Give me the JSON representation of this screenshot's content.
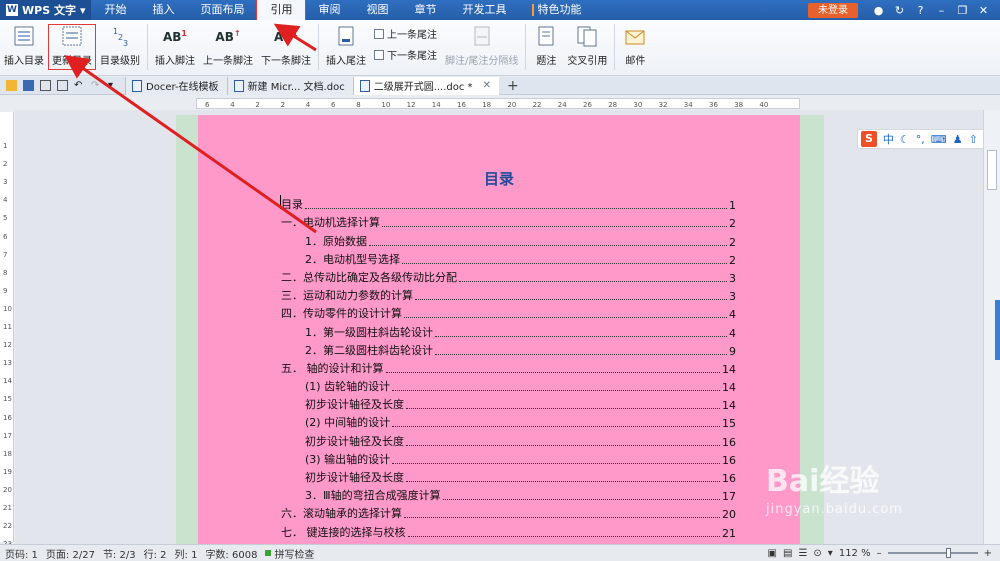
{
  "menubar": {
    "app_name": "WPS 文字",
    "tabs": [
      {
        "label": "开始"
      },
      {
        "label": "插入"
      },
      {
        "label": "页面布局"
      },
      {
        "label": "引用"
      },
      {
        "label": "审阅"
      },
      {
        "label": "视图"
      },
      {
        "label": "章节"
      },
      {
        "label": "开发工具"
      },
      {
        "label": "特色功能"
      }
    ],
    "active_tab": "引用",
    "login_label": "未登录"
  },
  "ribbon": {
    "insert_toc": "插入目录",
    "update_toc": "更新目录",
    "toc_level": "目录级别",
    "insert_footnote": "插入脚注",
    "prev_footnote": "上一条脚注",
    "next_footnote": "下一条脚注",
    "insert_endnote": "插入尾注",
    "prev_endnote": "上一条尾注",
    "next_endnote": "下一条尾注",
    "separator_line": "脚注/尾注分隔线",
    "caption": "题注",
    "cross_ref": "交叉引用",
    "mail": "邮件"
  },
  "tabs": [
    {
      "label": "Docer-在线模板"
    },
    {
      "label": "新建 Micr... 文档.doc"
    },
    {
      "label": "二级展开式圆....doc *"
    }
  ],
  "ruler_labels": [
    "6",
    "4",
    "2",
    "2",
    "4",
    "6",
    "8",
    "10",
    "12",
    "14",
    "16",
    "18",
    "20",
    "22",
    "24",
    "26",
    "28",
    "30",
    "32",
    "34",
    "36",
    "38",
    "40"
  ],
  "vruler_labels": [
    "1",
    "2",
    "3",
    "4",
    "5",
    "6",
    "7",
    "8",
    "9",
    "10",
    "11",
    "12",
    "13",
    "14",
    "15",
    "16",
    "17",
    "18",
    "19",
    "20",
    "21",
    "22",
    "23"
  ],
  "document": {
    "toc_title": "目录",
    "entries": [
      {
        "text": "目录",
        "page": "1",
        "level": 1
      },
      {
        "text": "一．电动机选择计算",
        "page": "2",
        "level": 1
      },
      {
        "text": "1．原始数据",
        "page": "2",
        "level": 2
      },
      {
        "text": "2．电动机型号选择",
        "page": "2",
        "level": 2
      },
      {
        "text": "二．总传动比确定及各级传动比分配",
        "page": "3",
        "level": 1
      },
      {
        "text": "三．运动和动力参数的计算",
        "page": "3",
        "level": 1
      },
      {
        "text": "四．传动零件的设计计算",
        "page": "4",
        "level": 1
      },
      {
        "text": "1．第一级圆柱斜齿轮设计",
        "page": "4",
        "level": 2
      },
      {
        "text": "2．第二级圆柱斜齿轮设计",
        "page": "9",
        "level": 2
      },
      {
        "text": "五．  轴的设计和计算",
        "page": "14",
        "level": 1
      },
      {
        "text": "(1)      齿轮轴的设计",
        "page": "14",
        "level": 3
      },
      {
        "text": "初步设计轴径及长度",
        "page": "14",
        "level": 3
      },
      {
        "text": "(2)      中间轴的设计",
        "page": "15",
        "level": 3
      },
      {
        "text": "初步设计轴径及长度",
        "page": "16",
        "level": 3
      },
      {
        "text": "(3)      输出轴的设计",
        "page": "16",
        "level": 3
      },
      {
        "text": "初步设计轴径及长度",
        "page": "16",
        "level": 3
      },
      {
        "text": "3．Ⅲ轴的弯扭合成强度计算",
        "page": "17",
        "level": 2
      },
      {
        "text": "六．滚动轴承的选择计算",
        "page": "20",
        "level": 1
      },
      {
        "text": "七．  键连接的选择与校核",
        "page": "21",
        "level": 1
      }
    ]
  },
  "ime": {
    "label": "中"
  },
  "status": {
    "page_no": "页码: 1",
    "pages": "页面: 2/27",
    "section": "节: 2/3",
    "row": "行: 2",
    "col": "列: 1",
    "word_count": "字数: 6008",
    "spell_check": "拼写检查",
    "zoom": "112 %"
  },
  "watermark": {
    "brand": "Bai经验",
    "url": "jingyan.baidu.com"
  },
  "colors": {
    "menubar": "#2f6fc0",
    "page": "#ff99c9",
    "toc_title": "#1f4a9a",
    "annotation": "#e02020",
    "green_margin": "#c9e3cf"
  }
}
